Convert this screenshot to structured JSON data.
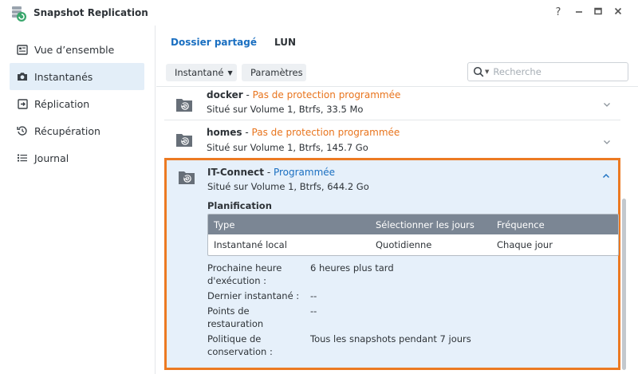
{
  "window": {
    "title": "Snapshot Replication",
    "controls": {
      "help": "?",
      "minimize": "—",
      "maximize": "◻",
      "close": "✕"
    }
  },
  "sidebar": {
    "items": [
      {
        "label": "Vue d’ensemble",
        "icon": "overview-icon",
        "active": false
      },
      {
        "label": "Instantanés",
        "icon": "camera-icon",
        "active": true
      },
      {
        "label": "Réplication",
        "icon": "replication-icon",
        "active": false
      },
      {
        "label": "Récupération",
        "icon": "recovery-icon",
        "active": false
      },
      {
        "label": "Journal",
        "icon": "log-list-icon",
        "active": false
      }
    ]
  },
  "tabs": [
    {
      "label": "Dossier partagé",
      "active": true
    },
    {
      "label": "LUN",
      "active": false
    }
  ],
  "toolbar": {
    "snapshot_button": "Instantané",
    "settings_button": "Paramètres",
    "search_placeholder": "Recherche"
  },
  "folders": [
    {
      "name": "docker",
      "separator": " - ",
      "status": "Pas de protection programmée",
      "location": "Situé sur Volume 1, Btrfs, 33.5 Mo"
    },
    {
      "name": "homes",
      "separator": " - ",
      "status": "Pas de protection programmée",
      "location": "Situé sur Volume 1, Btrfs, 145.7 Go"
    },
    {
      "name": "IT-Connect",
      "separator": " - ",
      "status": "Programmée",
      "location": "Situé sur Volume 1, Btrfs, 644.2 Go"
    }
  ],
  "details": {
    "plan_title": "Planification",
    "table": {
      "headers": [
        "Type",
        "Sélectionner les jours",
        "Fréquence"
      ],
      "rows": [
        [
          "Instantané local",
          "Quotidienne",
          "Chaque jour"
        ]
      ]
    },
    "next_run_label_1": "Prochaine heure",
    "next_run_label_2": "d'exécution :",
    "next_run_value": "6 heures plus tard",
    "last_snapshot_label": "Dernier instantané :",
    "last_snapshot_value": "--",
    "restore_points_label_1": "Points de restauration",
    "restore_points_label_2": ":",
    "restore_points_value": "--",
    "retention_label_1": "Politique de",
    "retention_label_2": "conservation :",
    "retention_value": "Tous les snapshots pendant 7 jours"
  },
  "colors": {
    "accent": "#1a6fc1",
    "warning": "#e8741d",
    "highlight_border": "#ec7a22",
    "expanded_bg": "#e6f0fa",
    "sidebar_active": "#e3eef8",
    "table_header": "#7b8694"
  }
}
